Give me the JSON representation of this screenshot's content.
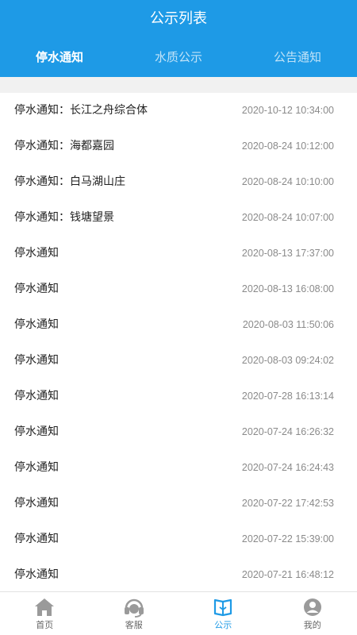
{
  "header": {
    "title": "公示列表",
    "tabs": [
      {
        "label": "停水通知",
        "active": true
      },
      {
        "label": "水质公示",
        "active": false
      },
      {
        "label": "公告通知",
        "active": false
      }
    ]
  },
  "list": [
    {
      "title": "停水通知：长江之舟综合体",
      "time": "2020-10-12 10:34:00"
    },
    {
      "title": "停水通知：海都嘉园",
      "time": "2020-08-24 10:12:00"
    },
    {
      "title": "停水通知：白马湖山庄",
      "time": "2020-08-24 10:10:00"
    },
    {
      "title": "停水通知：钱塘望景",
      "time": "2020-08-24 10:07:00"
    },
    {
      "title": "停水通知",
      "time": "2020-08-13 17:37:00"
    },
    {
      "title": "停水通知",
      "time": "2020-08-13 16:08:00"
    },
    {
      "title": "停水通知",
      "time": "2020-08-03 11:50:06"
    },
    {
      "title": "停水通知",
      "time": "2020-08-03 09:24:02"
    },
    {
      "title": "停水通知",
      "time": "2020-07-28 16:13:14"
    },
    {
      "title": "停水通知",
      "time": "2020-07-24 16:26:32"
    },
    {
      "title": "停水通知",
      "time": "2020-07-24 16:24:43"
    },
    {
      "title": "停水通知",
      "time": "2020-07-22 17:42:53"
    },
    {
      "title": "停水通知",
      "time": "2020-07-22 15:39:00"
    },
    {
      "title": "停水通知",
      "time": "2020-07-21 16:48:12"
    }
  ],
  "bottom_nav": [
    {
      "label": "首页",
      "icon": "home-icon",
      "active": false
    },
    {
      "label": "客服",
      "icon": "headset-icon",
      "active": false
    },
    {
      "label": "公示",
      "icon": "notice-book-icon",
      "active": true
    },
    {
      "label": "我的",
      "icon": "user-icon",
      "active": false
    }
  ],
  "colors": {
    "primary": "#1e9ae6",
    "inactive_icon": "#9a9a9a",
    "time_text": "#8a8a8a"
  }
}
